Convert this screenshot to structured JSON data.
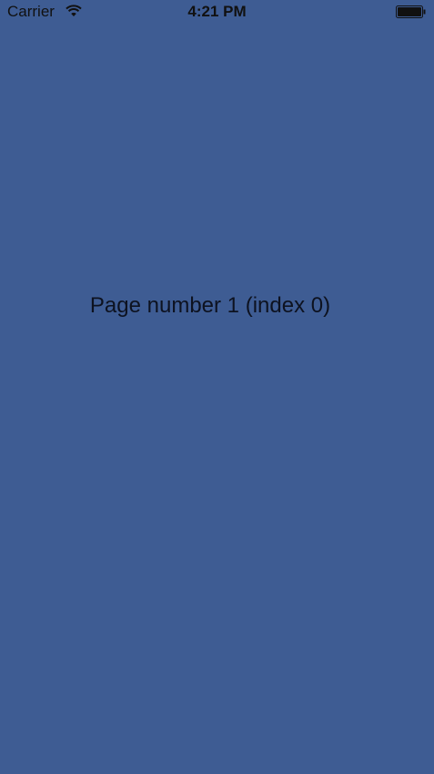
{
  "status_bar": {
    "carrier": "Carrier",
    "time": "4:21 PM",
    "wifi_icon": "wifi-icon",
    "battery_icon": "battery-icon"
  },
  "page": {
    "label": "Page number 1 (index 0)",
    "background_color": "#3e5c93"
  }
}
